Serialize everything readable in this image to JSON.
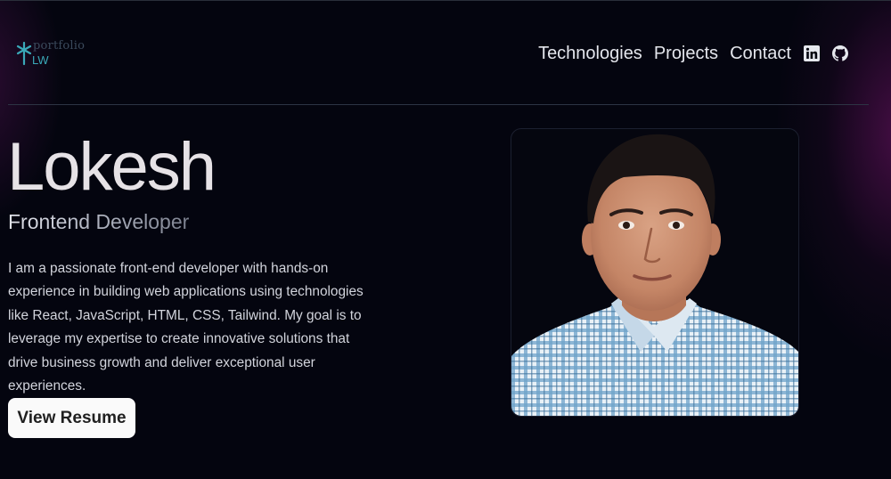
{
  "header": {
    "logo_word": "portfolio",
    "logo_initials": "LW",
    "nav": [
      {
        "label": "Technologies"
      },
      {
        "label": "Projects"
      },
      {
        "label": "Contact"
      }
    ],
    "social_icons": [
      "linkedin-icon",
      "github-icon"
    ]
  },
  "hero": {
    "name": "Lokesh",
    "role": "Frontend Developer",
    "bio": "I am a passionate front-end developer with hands-on experience in building web applications using technologies like React, JavaScript, HTML, CSS, Tailwind. My goal is to leverage my expertise to create innovative solutions that drive business growth and deliver exceptional user experiences.",
    "resume_button": "View Resume"
  },
  "colors": {
    "background": "#04050f",
    "accent_glow": "#78146e",
    "logo_accent": "#3aa8b8",
    "button_bg": "#fafafa"
  }
}
